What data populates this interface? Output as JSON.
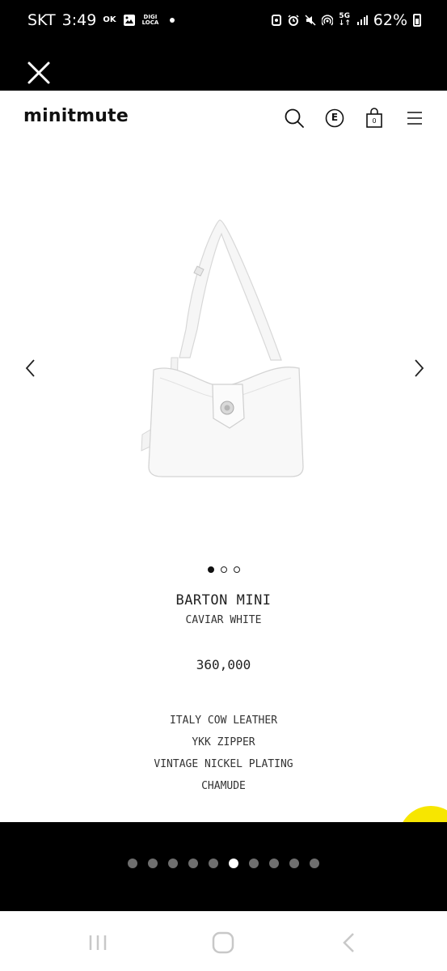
{
  "status_bar": {
    "carrier": "SKT",
    "time": "3:49",
    "ok_badge": "OK",
    "digi_top": "DIGI",
    "digi_bottom": "LOCA",
    "network": "5G",
    "battery": "62%"
  },
  "header": {
    "logo": "minitmute",
    "currency_label": "E",
    "cart_count": "0"
  },
  "product": {
    "name": "BARTON MINI",
    "color": "CAVIAR WHITE",
    "price": "360,000",
    "details": [
      "ITALY COW LEATHER",
      "YKK ZIPPER",
      "VINTAGE NICKEL PLATING",
      "CHAMUDE"
    ],
    "image_count": 3,
    "active_image": 0
  },
  "gallery": {
    "count": 10,
    "active": 5
  },
  "colors": {
    "fab": "#f7e600",
    "dot_inactive": "#6f6f6f",
    "dot_active": "#ffffff"
  }
}
